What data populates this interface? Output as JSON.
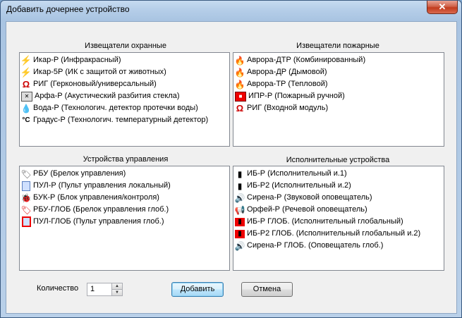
{
  "window": {
    "title": "Добавить дочернее устройство",
    "close_label": "✕"
  },
  "groups": [
    {
      "label": "Извещатели охранные",
      "items": [
        {
          "icon": "lightning-icon",
          "text": "Икар-Р (Инфракрасный)"
        },
        {
          "icon": "lightning-icon",
          "text": "Икар-5Р (ИК с защитой от животных)"
        },
        {
          "icon": "magnet-icon",
          "text": "РИГ (Герконовый/универсальный)"
        },
        {
          "icon": "glass-break-icon",
          "text": "Арфа-Р (Акустический разбития стекла)"
        },
        {
          "icon": "water-drop-icon",
          "text": "Вода-Р (Технологич. детектор протечки воды)"
        },
        {
          "icon": "thermometer-icon",
          "text": "Градус-Р (Технологич. температурный детектор)"
        }
      ]
    },
    {
      "label": "Извещатели пожарные",
      "items": [
        {
          "icon": "fire-detector-icon",
          "text": "Аврора-ДТР (Комбинированный)"
        },
        {
          "icon": "fire-detector-icon",
          "text": "Аврора-ДР (Дымовой)"
        },
        {
          "icon": "fire-detector-icon",
          "text": "Аврора-ТР (Тепловой)"
        },
        {
          "icon": "manual-call-point-icon",
          "text": "ИПР-Р (Пожарный ручной)"
        },
        {
          "icon": "magnet-icon",
          "text": "РИГ (Входной модуль)"
        }
      ]
    },
    {
      "label": "Устройства управления",
      "items": [
        {
          "icon": "key-fob-icon",
          "text": "РБУ (Брелок управления)"
        },
        {
          "icon": "keypad-icon",
          "text": "ПУЛ-Р (Пульт управления локальный)"
        },
        {
          "icon": "bug-icon",
          "text": "БУК-Р (Блок управления/контроля)"
        },
        {
          "icon": "key-fob-global-icon",
          "text": "РБУ-ГЛОБ (Брелок управления глоб.)"
        },
        {
          "icon": "keypad-global-icon",
          "text": "ПУЛ-ГЛОБ (Пульт управления глоб.)"
        }
      ]
    },
    {
      "label": "Исполнительные устройства",
      "items": [
        {
          "icon": "relay-icon",
          "text": "ИБ-Р (Исполнительный и.1)"
        },
        {
          "icon": "relay-icon",
          "text": "ИБ-Р2 (Исполнительный и.2)"
        },
        {
          "icon": "speaker-icon",
          "text": "Сирена-Р (Звуковой оповещатель)"
        },
        {
          "icon": "megaphone-icon",
          "text": "Орфей-Р (Речевой оповещатель)"
        },
        {
          "icon": "relay-global-icon",
          "text": "ИБ-Р ГЛОБ. (Исполнительный глобальный)"
        },
        {
          "icon": "relay-global-icon",
          "text": "ИБ-Р2 ГЛОБ. (Исполнительный глобальный и.2)"
        },
        {
          "icon": "speaker-global-icon",
          "text": "Сирена-Р ГЛОБ. (Оповещатель глоб.)"
        }
      ]
    }
  ],
  "quantity": {
    "label": "Количество",
    "value": "1"
  },
  "buttons": {
    "add": "Добавить",
    "cancel": "Отмена"
  }
}
